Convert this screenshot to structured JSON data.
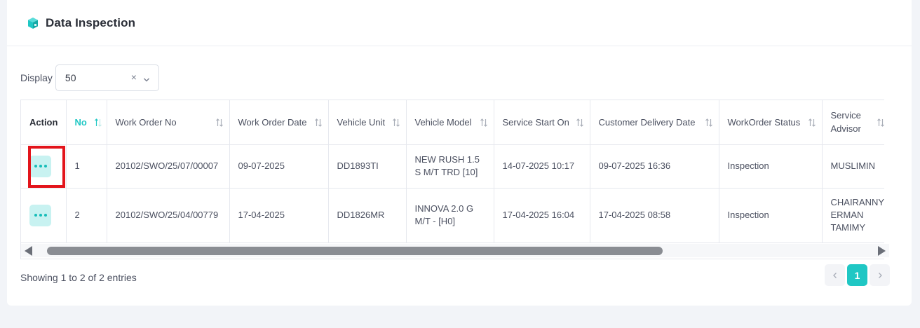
{
  "header": {
    "title": "Data Inspection",
    "icon": "cube-icon",
    "icon_color": "#1fc7c4"
  },
  "display": {
    "label": "Display",
    "value": "50"
  },
  "table": {
    "columns": [
      {
        "label": "Action",
        "sortable": false
      },
      {
        "label": "No",
        "sortable": true,
        "sort": "asc"
      },
      {
        "label": "Work Order No",
        "sortable": true
      },
      {
        "label": "Work Order Date",
        "sortable": true
      },
      {
        "label": "Vehicle Unit",
        "sortable": true
      },
      {
        "label": "Vehicle Model",
        "sortable": true
      },
      {
        "label": "Service Start On",
        "sortable": true
      },
      {
        "label": "Customer Delivery Date",
        "sortable": true
      },
      {
        "label": "WorkOrder Status",
        "sortable": true
      },
      {
        "label": "Service Advisor",
        "sortable": true
      }
    ],
    "rows": [
      {
        "no": "1",
        "work_order_no": "20102/SWO/25/07/00007",
        "work_order_date": "09-07-2025",
        "vehicle_unit": "DD1893TI",
        "vehicle_model": "NEW RUSH 1.5 S M/T TRD [10]",
        "service_start_on": "14-07-2025 10:17",
        "customer_delivery_date": "09-07-2025 16:36",
        "workorder_status": "Inspection",
        "service_advisor": "MUSLIMIN"
      },
      {
        "no": "2",
        "work_order_no": "20102/SWO/25/04/00779",
        "work_order_date": "17-04-2025",
        "vehicle_unit": "DD1826MR",
        "vehicle_model": "INNOVA 2.0 G M/T - [H0]",
        "service_start_on": "17-04-2025 16:04",
        "customer_delivery_date": "17-04-2025 08:58",
        "workorder_status": "Inspection",
        "service_advisor": "CHAIRANNY ERMAN TAMIMY"
      }
    ]
  },
  "footer": {
    "entries_text": "Showing 1 to 2 of 2 entries"
  },
  "pagination": {
    "current": "1"
  },
  "colors": {
    "accent": "#1fc7c4",
    "highlight": "#e3141b"
  }
}
